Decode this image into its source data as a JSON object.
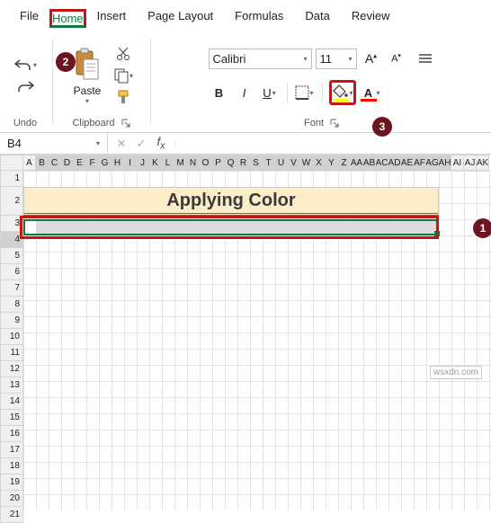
{
  "menu": {
    "tabs": [
      "File",
      "Home",
      "Insert",
      "Page Layout",
      "Formulas",
      "Data",
      "Review"
    ],
    "active": "Home"
  },
  "ribbon": {
    "undo_group": {
      "label": "Undo"
    },
    "clipboard_group": {
      "label": "Clipboard",
      "paste_label": "Paste"
    },
    "font_group": {
      "label": "Font",
      "font_name": "Calibri",
      "font_size": "11",
      "bold": "B",
      "italic": "I",
      "underline": "U"
    }
  },
  "namebox": {
    "value": "B4"
  },
  "formula_bar": {
    "value": ""
  },
  "columns": [
    "A",
    "B",
    "C",
    "D",
    "E",
    "F",
    "G",
    "H",
    "I",
    "J",
    "K",
    "L",
    "M",
    "N",
    "O",
    "P",
    "Q",
    "R",
    "S",
    "T",
    "U",
    "V",
    "W",
    "X",
    "Y",
    "Z",
    "AA",
    "AB",
    "AC",
    "AD",
    "AE",
    "AF",
    "AG",
    "AH",
    "AI",
    "AJ",
    "AK"
  ],
  "rows": [
    "1",
    "2",
    "3",
    "4",
    "5",
    "6",
    "7",
    "8",
    "9",
    "10",
    "11",
    "12",
    "13",
    "14",
    "15",
    "16",
    "17",
    "18",
    "19",
    "20",
    "21"
  ],
  "sheet": {
    "title_text": "Applying Color",
    "selected_row": 4
  },
  "annotations": {
    "badge1": "1",
    "badge2": "2",
    "badge3": "3"
  },
  "watermark": "wsxdn.com"
}
